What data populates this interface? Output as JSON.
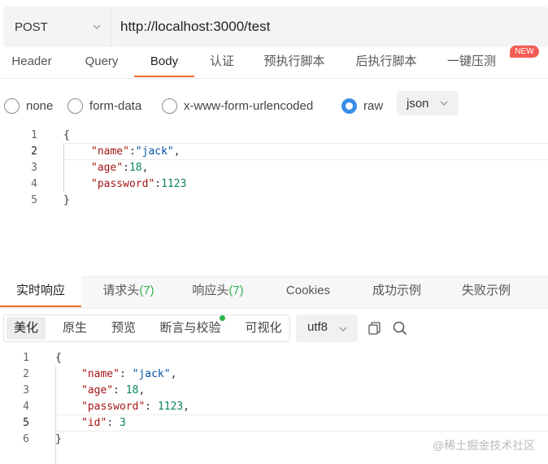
{
  "request": {
    "method": "POST",
    "url": "http://localhost:3000/test",
    "tabs": [
      "Header",
      "Query",
      "Body",
      "认证",
      "预执行脚本",
      "后执行脚本",
      "一键压测"
    ],
    "active_tab": "Body",
    "new_badge": "NEW"
  },
  "body_types": {
    "options": [
      "none",
      "form-data",
      "x-www-form-urlencoded",
      "raw"
    ],
    "selected": "raw",
    "format": "json"
  },
  "request_body": {
    "line_numbers": [
      "1",
      "2",
      "3",
      "4",
      "5"
    ],
    "lines": [
      [
        {
          "t": "p",
          "v": "{"
        }
      ],
      [
        {
          "t": "k",
          "v": "\"name\""
        },
        {
          "t": "p",
          "v": ":"
        },
        {
          "t": "s",
          "v": "\"jack\""
        },
        {
          "t": "p",
          "v": ","
        }
      ],
      [
        {
          "t": "k",
          "v": "\"age\""
        },
        {
          "t": "p",
          "v": ":"
        },
        {
          "t": "n",
          "v": "18"
        },
        {
          "t": "p",
          "v": ","
        }
      ],
      [
        {
          "t": "k",
          "v": "\"password\""
        },
        {
          "t": "p",
          "v": ":"
        },
        {
          "t": "n",
          "v": "1123"
        }
      ],
      [
        {
          "t": "p",
          "v": "}"
        }
      ]
    ]
  },
  "response": {
    "tabs": [
      "实时响应",
      "请求头",
      "响应头",
      "Cookies",
      "成功示例",
      "失败示例"
    ],
    "req_headers_count": "(7)",
    "res_headers_count": "(7)",
    "active_tab": "实时响应",
    "view_modes": [
      "美化",
      "原生",
      "预览",
      "断言与校验",
      "可视化"
    ],
    "active_mode": "美化",
    "encoding": "utf8"
  },
  "response_body": {
    "line_numbers": [
      "1",
      "2",
      "3",
      "4",
      "5",
      "6"
    ],
    "lines": [
      [
        {
          "t": "p",
          "v": "{"
        }
      ],
      [
        {
          "t": "k",
          "v": "\"name\""
        },
        {
          "t": "p",
          "v": ": "
        },
        {
          "t": "s",
          "v": "\"jack\""
        },
        {
          "t": "p",
          "v": ","
        }
      ],
      [
        {
          "t": "k",
          "v": "\"age\""
        },
        {
          "t": "p",
          "v": ": "
        },
        {
          "t": "n",
          "v": "18"
        },
        {
          "t": "p",
          "v": ","
        }
      ],
      [
        {
          "t": "k",
          "v": "\"password\""
        },
        {
          "t": "p",
          "v": ": "
        },
        {
          "t": "n",
          "v": "1123"
        },
        {
          "t": "p",
          "v": ","
        }
      ],
      [
        {
          "t": "k",
          "v": "\"id\""
        },
        {
          "t": "p",
          "v": ": "
        },
        {
          "t": "n",
          "v": "3"
        }
      ],
      [
        {
          "t": "p",
          "v": "}"
        }
      ]
    ]
  },
  "watermark": "@稀土掘金技术社区",
  "icons": {
    "method_dropdown": "chevron-down-icon",
    "format_dropdown": "chevron-down-icon",
    "copy": "copy-icon",
    "search": "search-icon"
  },
  "colors": {
    "accent": "#f26b2f",
    "radio_selected": "#3a8ee6",
    "count_green": "#2bb24c",
    "badge_red": "#f25c54",
    "json_key": "#a31515",
    "json_string": "#0451a5",
    "json_number": "#098658"
  }
}
